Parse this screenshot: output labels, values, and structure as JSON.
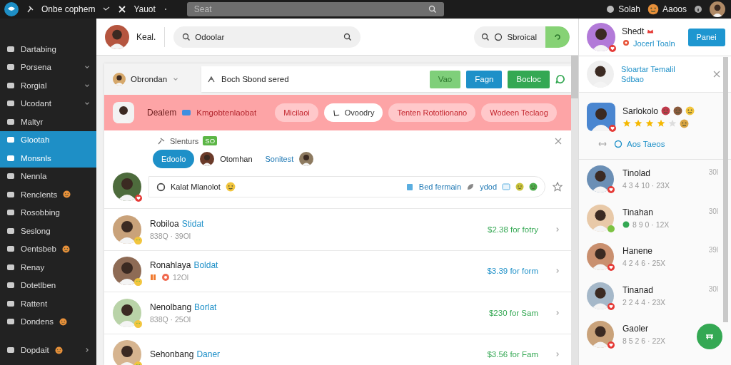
{
  "topbar": {
    "app_name": "Onbe cophem",
    "menu_label": "Yauot",
    "search": {
      "placeholder": "Seat"
    },
    "links": [
      "Solah",
      "Aaoos"
    ]
  },
  "sidebar": {
    "items": [
      {
        "label": "Dartabing",
        "kind": "link",
        "selected": false,
        "reaction": false
      },
      {
        "label": "Porsena",
        "kind": "dropdown",
        "selected": false,
        "reaction": false
      },
      {
        "label": "Rorgial",
        "kind": "dropdown",
        "selected": false,
        "reaction": false
      },
      {
        "label": "Ucodant",
        "kind": "dropdown",
        "selected": false,
        "reaction": false
      },
      {
        "label": "Maltyr",
        "kind": "link",
        "selected": false,
        "reaction": false
      },
      {
        "label": "Glootah",
        "kind": "link",
        "selected": true,
        "reaction": false
      },
      {
        "label": "Monsnls",
        "kind": "link",
        "selected": true,
        "reaction": false
      },
      {
        "label": "Nennla",
        "kind": "link",
        "selected": false,
        "reaction": false
      },
      {
        "label": "Renclents",
        "kind": "link",
        "selected": false,
        "reaction": true
      },
      {
        "label": "Rosobbing",
        "kind": "link",
        "selected": false,
        "reaction": false
      },
      {
        "label": "Seslong",
        "kind": "link",
        "selected": false,
        "reaction": false
      },
      {
        "label": "Oentsbeb",
        "kind": "link",
        "selected": false,
        "reaction": true
      },
      {
        "label": "Renay",
        "kind": "link",
        "selected": false,
        "reaction": false
      },
      {
        "label": "Dotetlben",
        "kind": "link",
        "selected": false,
        "reaction": false
      },
      {
        "label": "Rattent",
        "kind": "link",
        "selected": false,
        "reaction": false
      },
      {
        "label": "Dondens",
        "kind": "link",
        "selected": false,
        "reaction": true
      },
      {
        "label": "Dopdait",
        "kind": "submenu",
        "selected": false,
        "reaction": true
      }
    ]
  },
  "header": {
    "user_name": "Keal.",
    "search": {
      "value": "Odoolar"
    },
    "filter": {
      "label": "Sbroical"
    }
  },
  "feed": {
    "account": "Obrondan",
    "title_field": {
      "value": "Boch Sbond sered"
    },
    "buttons": [
      {
        "label": "Vao",
        "kind": "light"
      },
      {
        "label": "Fagn",
        "kind": "primary"
      },
      {
        "label": "Bocloc",
        "kind": "success"
      }
    ],
    "banner": {
      "name": "Dealem",
      "text": "Kmgobtenlaobat",
      "chips": [
        {
          "label": "Micilaoi",
          "selected": false
        },
        {
          "label": "Ovoodry",
          "selected": true
        },
        {
          "label": "Tenten Rototlionano",
          "selected": false
        },
        {
          "label": "Wodeen Teclaog",
          "selected": false
        }
      ]
    },
    "post": {
      "label": "Slenturs",
      "badge": "SO",
      "bubble": "Edoolo",
      "author": "Otomhan",
      "link": "Sonitest",
      "composer": {
        "value": "Kalat Mlanolot"
      },
      "attachment": "Bed fermain",
      "tag": "ydod"
    },
    "rows": [
      {
        "name": "Robiloa",
        "tag": "Stidat",
        "meta": "838Q · 39Ol",
        "price": "$2.38 for fotry",
        "color": "#34a853"
      },
      {
        "name": "Ronahlaya",
        "tag": "Boldat",
        "meta": "12Ol",
        "price": "$3.39 for form",
        "color": "#1e90c8"
      },
      {
        "name": "Nenolbang",
        "tag": "Borlat",
        "meta": "838Q · 25Ol",
        "price": "$230 for Sam",
        "color": "#34a853"
      },
      {
        "name": "Sehonbang",
        "tag": "Daner",
        "price": "$3.56 for Fam",
        "color": "#34a853"
      }
    ]
  },
  "right": {
    "profile": {
      "name": "Shedt",
      "team": "Jocerl Toaln",
      "button": "Panei"
    },
    "notice": {
      "title": "Sloartar Temalil",
      "subtitle": "Sdbao"
    },
    "featured": {
      "name": "Sarlokolo",
      "stars": 4,
      "link": "Aos Taeos"
    },
    "contacts": [
      {
        "name": "Tinolad",
        "time": "30l",
        "meta": "4 3 4 10 · 23X",
        "online": false
      },
      {
        "name": "Tinahan",
        "time": "30l",
        "meta": "8 9 0 · 12X",
        "online": true
      },
      {
        "name": "Hanene",
        "time": "39l",
        "meta": "4 2 4 6 · 25X",
        "online": false
      },
      {
        "name": "Tinanad",
        "time": "30l",
        "meta": "2 2 4 4 · 23X",
        "online": false
      },
      {
        "name": "Gaoler",
        "meta": "8 5 2 6 · 22X",
        "online": false
      }
    ]
  }
}
